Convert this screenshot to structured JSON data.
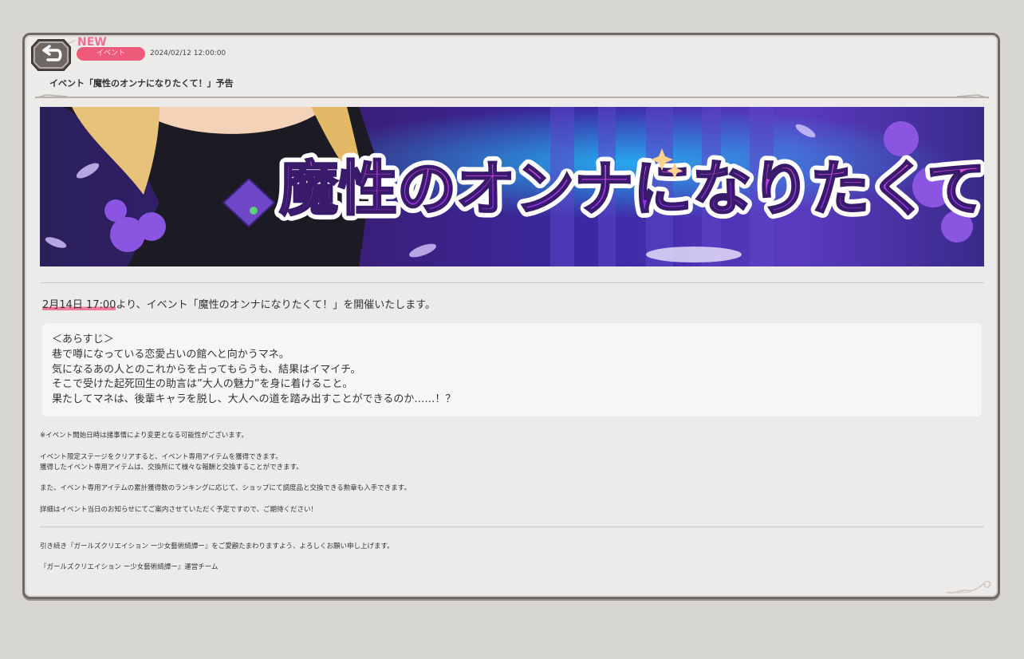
{
  "header": {
    "new_badge": "NEW",
    "category": "イベント",
    "datetime": "2024/02/12 12:00:00",
    "title": "イベント「魔性のオンナになりたくて！」予告"
  },
  "banner": {
    "title_text": "魔性のオンナになりたくて！"
  },
  "body": {
    "intro_date": "2月14日 17:00",
    "intro_rest": "より、イベント「魔性のオンナになりたくて！」を開催いたします。",
    "synopsis": [
      "＜あらすじ＞",
      "巷で噂になっている恋愛占いの館へと向かうマネ。",
      "気になるあの人とのこれからを占ってもらうも、結果はイマイチ。",
      "そこで受けた起死回生の助言は”大人の魅力”を身に着けること。",
      "果たしてマネは、後輩キャラを脱し、大人への道を踏み出すことができるのか……！？"
    ],
    "notes": [
      "※イベント開始日時は諸事情により変更となる可能性がございます。",
      "イベント限定ステージをクリアすると、イベント専用アイテムを獲得できます。",
      "獲得したイベント専用アイテムは、交換所にて様々な報酬と交換することができます。",
      "また、イベント専用アイテムの累計獲得数のランキングに応じて、ショップにて調度品と交換できる勲章も入手できます。",
      "詳細はイベント当日のお知らせにてご案内させていただく予定ですので、ご期待ください！"
    ],
    "closing": "引き続き『ガールズクリエイション ー少女藝術綺譚ー』をご愛顧たまわりますよう、よろしくお願い申し上げます。",
    "signature": "『ガールズクリエイション ー少女藝術綺譚ー』運営チーム"
  },
  "colors": {
    "accent_pink": "#ee5b7a",
    "panel_bg": "#ecebea",
    "page_bg": "#d7d6d1",
    "frame": "#6f6863"
  },
  "icons": {
    "back": "back-arrow-icon"
  }
}
